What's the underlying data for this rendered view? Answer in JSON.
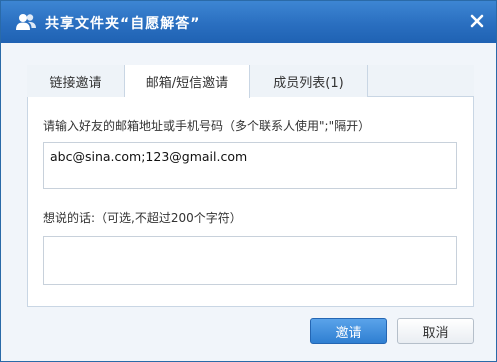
{
  "window": {
    "title": "共享文件夹“自愿解答”",
    "title_icon": "users-icon",
    "close_icon": "close-icon"
  },
  "tabs": [
    {
      "label": "链接邀请",
      "active": false
    },
    {
      "label": "邮箱/短信邀请",
      "active": true
    },
    {
      "label": "成员列表(1)",
      "active": false
    }
  ],
  "form": {
    "contacts_label": "请输入好友的邮箱地址或手机号码（多个联系人使用\";\"隔开）",
    "contacts_value": "abc@sina.com;123@gmail.com",
    "message_label": "想说的话:（可选,不超过200个字符）",
    "message_value": ""
  },
  "buttons": {
    "invite": "邀请",
    "cancel": "取消"
  },
  "colors": {
    "titlebar": "#2a6fc0",
    "accent": "#2f7fd2"
  }
}
